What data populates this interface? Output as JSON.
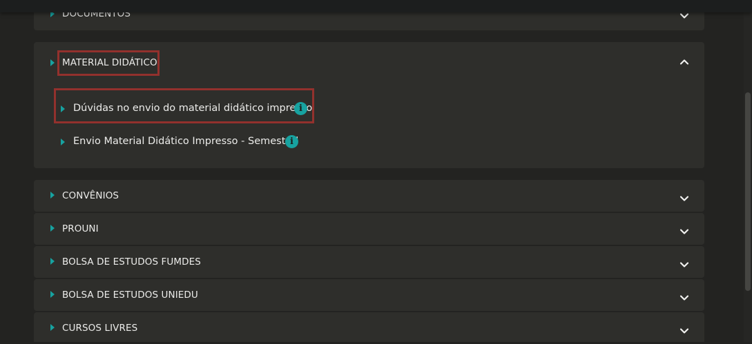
{
  "sections": {
    "documentos": {
      "title": "DOCUMENTOS",
      "expanded": false
    },
    "material": {
      "title": "MATERIAL DIDÁTICO",
      "expanded": true,
      "items": [
        {
          "label": "Dúvidas no envio do material didático impresso",
          "icon": "info-icon"
        },
        {
          "label": "Envio Material Didático Impresso - Semestral",
          "icon": "info-icon"
        }
      ]
    },
    "convenios": {
      "title": "CONVÊNIOS",
      "expanded": false
    },
    "prouni": {
      "title": "PROUNI",
      "expanded": false
    },
    "fumdes": {
      "title": "BOLSA DE ESTUDOS FUMDES",
      "expanded": false
    },
    "uniedu": {
      "title": "BOLSA DE ESTUDOS UNIEDU",
      "expanded": false
    },
    "cursos": {
      "title": "CURSOS LIVRES",
      "expanded": false
    }
  },
  "info_glyph": "i",
  "colors": {
    "accent": "#17a2a0",
    "highlight": "#93312d",
    "panel": "#2e2e2b",
    "background": "#232321"
  }
}
